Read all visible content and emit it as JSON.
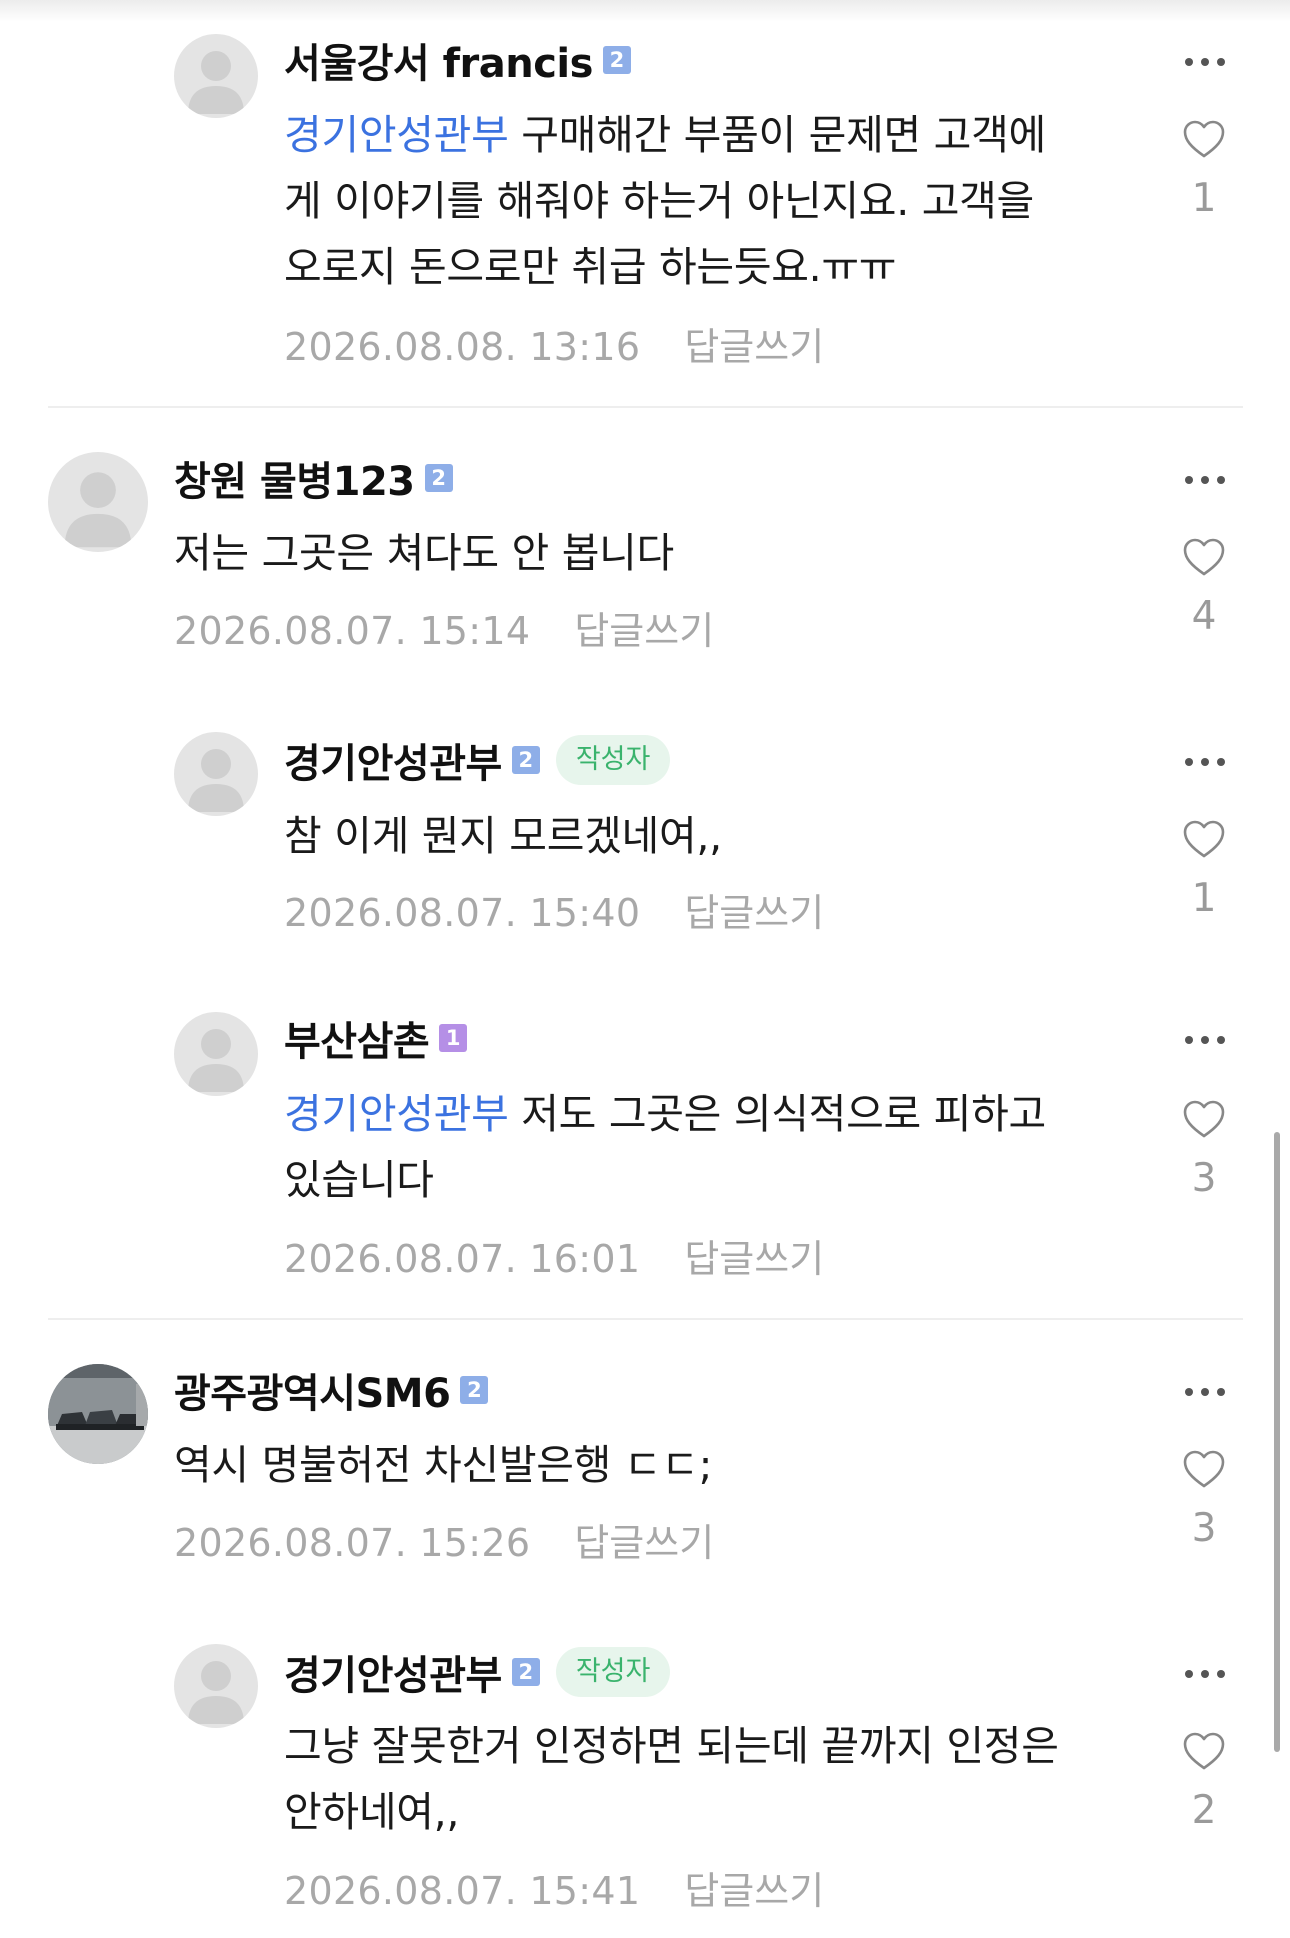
{
  "comments": [
    {
      "author": "서울강서 francis",
      "level": "2",
      "is_writer": false,
      "mention": "경기안성관부",
      "lines": [
        "구매해간 부품이 문제면 고객에",
        "게 이야기를 해줘야 하는거 아닌지요. 고객을",
        "오로지 돈으로만 취급 하는듯요.ㅠㅠ"
      ],
      "date": "2026.08.08. 13:16",
      "reply_label": "답글쓰기",
      "likes": "1"
    },
    {
      "author": "창원 물병123",
      "level": "2",
      "is_writer": false,
      "mention": "",
      "lines": [
        "저는 그곳은 쳐다도 안 봅니다"
      ],
      "date": "2026.08.07. 15:14",
      "reply_label": "답글쓰기",
      "likes": "4"
    },
    {
      "author": "경기안성관부",
      "level": "2",
      "is_writer": true,
      "writer_badge": "작성자",
      "mention": "",
      "lines": [
        "참 이게 뭔지 모르겠네여,,"
      ],
      "date": "2026.08.07. 15:40",
      "reply_label": "답글쓰기",
      "likes": "1"
    },
    {
      "author": "부산삼촌",
      "level": "1",
      "is_writer": false,
      "mention": "경기안성관부",
      "lines": [
        "저도 그곳은 의식적으로 피하고",
        "있습니다"
      ],
      "date": "2026.08.07. 16:01",
      "reply_label": "답글쓰기",
      "likes": "3"
    },
    {
      "author": "광주광역시SM6",
      "level": "2",
      "is_writer": false,
      "mention": "",
      "lines": [
        "역시 명불허전 차신발은행 ㄷㄷ;"
      ],
      "date": "2026.08.07. 15:26",
      "reply_label": "답글쓰기",
      "likes": "3"
    },
    {
      "author": "경기안성관부",
      "level": "2",
      "is_writer": true,
      "writer_badge": "작성자",
      "mention": "",
      "lines": [
        "그냥 잘못한거 인정하면 되는데 끝까지 인정은",
        "안하네여,,"
      ],
      "date": "2026.08.07. 15:41",
      "reply_label": "답글쓰기",
      "likes": "2"
    }
  ],
  "colors": {
    "mention": "#3b72e0",
    "writer_badge_bg": "#e7f5ec",
    "writer_badge_text": "#3ab36d",
    "level2": "#8eaee8",
    "level1": "#b58fe6",
    "meta": "#a8a8a8"
  },
  "icons": {
    "more": "more-dots-icon",
    "like": "heart-icon",
    "avatar": "user-silhouette-icon"
  }
}
